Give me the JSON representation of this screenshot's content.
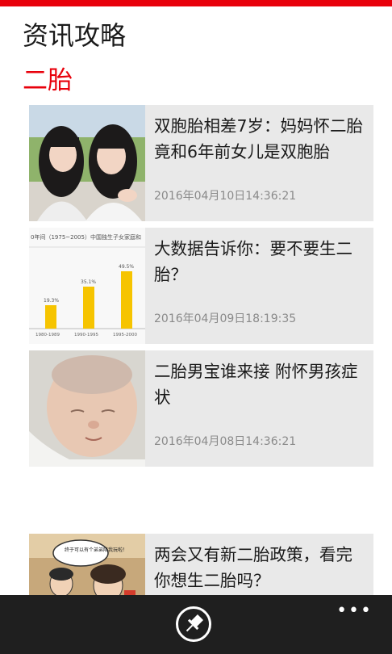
{
  "app": {
    "title": "资讯攻略"
  },
  "section": {
    "title": "二胎"
  },
  "articles": [
    {
      "title": "双胞胎相差7岁：妈妈怀二胎竟和6年前女儿是双胞胎",
      "date": "2016年04月10日14:36:21",
      "thumb": "twin-girls-photo"
    },
    {
      "title": "大数据告诉你：要不要生二胎？",
      "date": "2016年04月09日18:19:35",
      "thumb": "bar-chart-image",
      "thumb_text": {
        "heading": "0年间（1975~2005）中国独生子女家庭和",
        "bars": [
          "19.3%",
          "35.1%",
          "49.5%"
        ],
        "labels": [
          "1980-1989",
          "1990-1995",
          "1995-2000"
        ]
      }
    },
    {
      "title": "二胎男宝谁来接 附怀男孩症状",
      "date": "2016年04月08日14:36:21",
      "thumb": "sleeping-baby-photo"
    },
    {
      "title": "两会又有新二胎政策，看完你想生二胎吗？",
      "date": "",
      "thumb": "cartoon-family",
      "thumb_text": {
        "bubble": "终于可以有个弟弟陪我玩啦！"
      }
    }
  ],
  "appbar": {
    "pin_icon": "pin-icon",
    "more_label": "•••"
  },
  "colors": {
    "accent": "#e8000b",
    "card": "#e9e9e9",
    "appbar": "#1f1f1f"
  }
}
